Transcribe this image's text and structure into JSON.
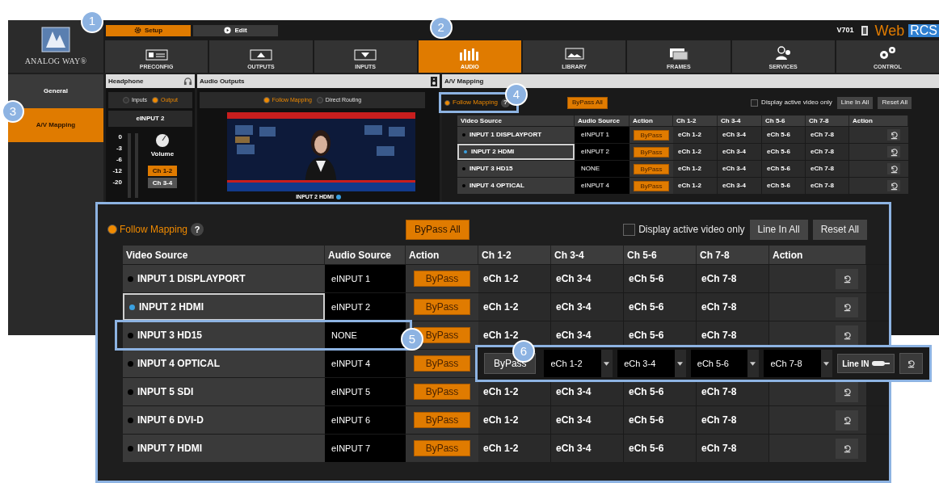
{
  "top_bar": {
    "logo_text": "ANALOG WAY®",
    "mode_tabs": [
      {
        "label": "Setup",
        "kind": "gear",
        "selected": true,
        "callout": "1"
      },
      {
        "label": "Edit",
        "kind": "play",
        "selected": false
      }
    ],
    "version": "V701",
    "brand_web": "Web",
    "brand_rcs": "RCS"
  },
  "main_tabs": [
    {
      "label": "PRECONFIG",
      "kind": "preconfig",
      "selected": false
    },
    {
      "label": "OUTPUTS",
      "kind": "outputs",
      "selected": false
    },
    {
      "label": "INPUTS",
      "kind": "inputs",
      "selected": false
    },
    {
      "label": "AUDIO",
      "kind": "audio",
      "selected": true,
      "callout": "2"
    },
    {
      "label": "LIBRARY",
      "kind": "library",
      "selected": false
    },
    {
      "label": "FRAMES",
      "kind": "frames",
      "selected": false
    },
    {
      "label": "SERVICES",
      "kind": "services",
      "selected": false
    },
    {
      "label": "CONTROL",
      "kind": "control",
      "selected": false
    }
  ],
  "sidebar": {
    "items": [
      {
        "label": "General",
        "selected": false
      },
      {
        "label": "A/V Mapping",
        "selected": true,
        "callout": "3"
      }
    ]
  },
  "headphone": {
    "title": "Headphone",
    "source_options": [
      {
        "label": "Inputs",
        "selected": false
      },
      {
        "label": "Output",
        "selected": true
      }
    ],
    "source": "eINPUT 2",
    "scale": [
      "0",
      "-3",
      "-6",
      "-12",
      "-20"
    ],
    "volume_label": "Volume",
    "channels": [
      {
        "label": "Ch 1-2",
        "selected": true
      },
      {
        "label": "Ch 3-4",
        "selected": false
      }
    ]
  },
  "audio_outputs": {
    "title": "Audio Outputs",
    "modes": [
      {
        "label": "Follow Mapping",
        "selected": true
      },
      {
        "label": "Direct Routing",
        "selected": false
      }
    ],
    "preview_caption": "INPUT 2  HDMI"
  },
  "av_mapping": {
    "title": "A/V Mapping",
    "follow_mapping": {
      "label": "Follow Mapping",
      "help": "?",
      "selected": true,
      "callout": "4"
    },
    "bypass_all": "ByPass All",
    "display_active": {
      "label": "Display active video only",
      "checked": false
    },
    "line_in_all": "Line In All",
    "reset_all": "Reset All",
    "columns": [
      "Video Source",
      "Audio Source",
      "Action",
      "Ch 1-2",
      "Ch 3-4",
      "Ch 5-6",
      "Ch 7-8",
      "Action"
    ],
    "rows": [
      {
        "video_source": "INPUT 1 DISPLAYPORT",
        "color": "#000000",
        "selected": false,
        "audio_source": "eINPUT 1",
        "action": "ByPass",
        "channels": [
          "eCh 1-2",
          "eCh 3-4",
          "eCh 5-6",
          "eCh 7-8"
        ]
      },
      {
        "video_source": "INPUT 2 HDMI",
        "color": "#3aa0e0",
        "selected": true,
        "audio_source": "eINPUT 2",
        "action": "ByPass",
        "channels": [
          "eCh 1-2",
          "eCh 3-4",
          "eCh 5-6",
          "eCh 7-8"
        ]
      },
      {
        "video_source": "INPUT 3 HD15",
        "color": "#000000",
        "selected": false,
        "audio_source": "NONE",
        "action": "ByPass",
        "channels": [
          "eCh 1-2",
          "eCh 3-4",
          "eCh 5-6",
          "eCh 7-8"
        ]
      },
      {
        "video_source": "INPUT 4 OPTICAL",
        "color": "#000000",
        "selected": false,
        "audio_source": "eINPUT 4",
        "action": "ByPass",
        "channels": [
          "eCh 1-2",
          "eCh 3-4",
          "eCh 5-6",
          "eCh 7-8"
        ]
      }
    ]
  },
  "zoom_panel": {
    "follow_mapping": {
      "label": "Follow Mapping",
      "help": "?",
      "selected": true
    },
    "bypass_all": "ByPass All",
    "display_active": {
      "label": "Display active video only",
      "checked": false
    },
    "line_in_all": "Line In All",
    "reset_all": "Reset All",
    "columns": [
      "Video Source",
      "Audio Source",
      "Action",
      "Ch 1-2",
      "Ch 3-4",
      "Ch 5-6",
      "Ch 7-8",
      "Action"
    ],
    "rows": [
      {
        "video_source": "INPUT 1 DISPLAYPORT",
        "color": "#000000",
        "selected": false,
        "audio_source": "eINPUT 1",
        "action": "ByPass",
        "channels": [
          "eCh 1-2",
          "eCh 3-4",
          "eCh 5-6",
          "eCh 7-8"
        ]
      },
      {
        "video_source": "INPUT 2 HDMI",
        "color": "#3aa0e0",
        "selected": true,
        "audio_source": "eINPUT 2",
        "action": "ByPass",
        "channels": [
          "eCh 1-2",
          "eCh 3-4",
          "eCh 5-6",
          "eCh 7-8"
        ]
      },
      {
        "video_source": "INPUT 3 HD15",
        "color": "#000000",
        "selected": false,
        "audio_source": "NONE",
        "action": "ByPass",
        "channels": [
          "eCh 1-2",
          "eCh 3-4",
          "eCh 5-6",
          "eCh 7-8"
        ],
        "callout": "5"
      },
      {
        "video_source": "INPUT 4 OPTICAL",
        "color": "#000000",
        "selected": false,
        "audio_source": "eINPUT 4",
        "action": "ByPass"
      },
      {
        "video_source": "INPUT 5 SDI",
        "color": "#000000",
        "selected": false,
        "audio_source": "eINPUT 5",
        "action": "ByPass",
        "channels": [
          "eCh 1-2",
          "eCh 3-4",
          "eCh 5-6",
          "eCh 7-8"
        ]
      },
      {
        "video_source": "INPUT 6 DVI-D",
        "color": "#000000",
        "selected": false,
        "audio_source": "eINPUT 6",
        "action": "ByPass",
        "channels": [
          "eCh 1-2",
          "eCh 3-4",
          "eCh 5-6",
          "eCh 7-8"
        ]
      },
      {
        "video_source": "INPUT 7 HDMI",
        "color": "#000000",
        "selected": false,
        "audio_source": "eINPUT 7",
        "action": "ByPass",
        "channels": [
          "eCh 1-2",
          "eCh 3-4",
          "eCh 5-6",
          "eCh 7-8"
        ]
      }
    ]
  },
  "edit_strip": {
    "callout": "6",
    "bypass": "ByPass",
    "channels": [
      "eCh 1-2",
      "eCh 3-4",
      "eCh 5-6",
      "eCh 7-8"
    ],
    "line_in": "Line IN"
  }
}
